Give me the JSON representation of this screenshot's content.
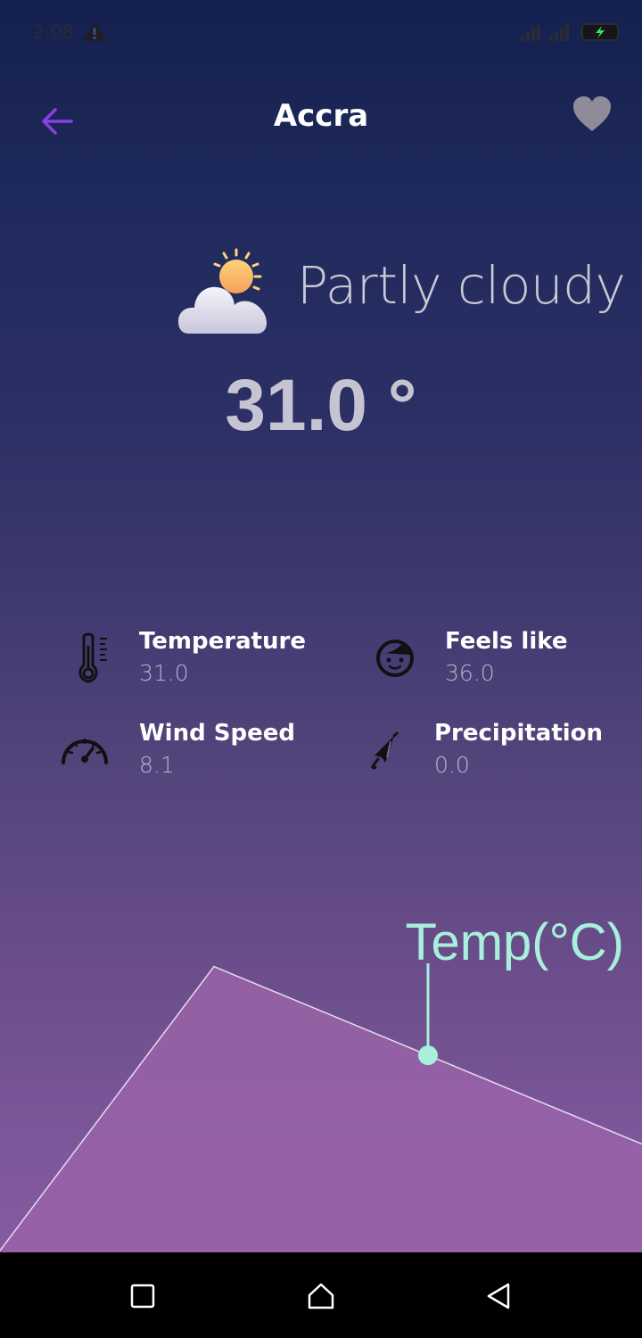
{
  "status_bar": {
    "time": "2:08",
    "dots": "···"
  },
  "header": {
    "city": "Accra",
    "back_icon": "arrow-left-icon",
    "favorite_icon": "heart-icon"
  },
  "current": {
    "condition": "Partly cloudy",
    "temperature": "31.0 °",
    "icon": "partly-cloudy-icon"
  },
  "stats": {
    "temperature": {
      "label": "Temperature",
      "value": "31.0",
      "icon": "thermometer-icon"
    },
    "feels_like": {
      "label": "Feels like",
      "value": "36.0",
      "icon": "face-icon"
    },
    "wind_speed": {
      "label": "Wind Speed",
      "value": "8.1",
      "icon": "speedometer-icon"
    },
    "precipitation": {
      "label": "Precipitation",
      "value": "0.0",
      "icon": "umbrella-icon"
    }
  },
  "chart_data": {
    "type": "area",
    "title": "",
    "tooltip_label": "Temp(°C)",
    "series": [
      {
        "values": [
          20,
          36,
          31,
          26
        ]
      }
    ],
    "ylim": [
      20,
      40
    ],
    "grid": false,
    "colors": {
      "fill": "#9a63a8",
      "line": "#e8dcef",
      "marker": "#a8f0dc"
    }
  },
  "nav": {
    "recent_icon": "square-icon",
    "home_icon": "home-icon",
    "back_icon": "triangle-back-icon"
  },
  "colors": {
    "accent": "#8b3fe0",
    "heart": "#8e8c99",
    "tooltip": "#a8f0dc"
  }
}
